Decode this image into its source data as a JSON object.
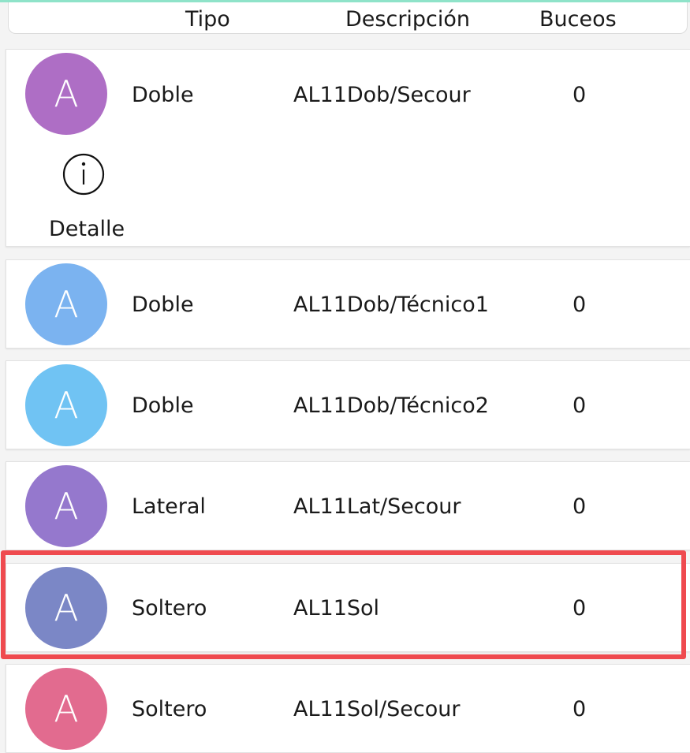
{
  "header": {
    "col_tipo": "Tipo",
    "col_descripcion": "Descripción",
    "col_buceos": "Buceos"
  },
  "rows": [
    {
      "avatar_letter": "A",
      "avatar_color": "#ae6ec5",
      "tipo": "Doble",
      "descripcion": "AL11Dob/Secour",
      "buceos": "0"
    },
    {
      "avatar_letter": "A",
      "avatar_color": "#7bb3f0",
      "tipo": "Doble",
      "descripcion": "AL11Dob/Técnico1",
      "buceos": "0"
    },
    {
      "avatar_letter": "A",
      "avatar_color": "#70c3f3",
      "tipo": "Doble",
      "descripcion": "AL11Dob/Técnico2",
      "buceos": "0"
    },
    {
      "avatar_letter": "A",
      "avatar_color": "#9578cd",
      "tipo": "Lateral",
      "descripcion": "AL11Lat/Secour",
      "buceos": "0"
    },
    {
      "avatar_letter": "A",
      "avatar_color": "#7b87c6",
      "tipo": "Soltero",
      "descripcion": "AL11Sol",
      "buceos": "0"
    },
    {
      "avatar_letter": "A",
      "avatar_color": "#e26b8f",
      "tipo": "Soltero",
      "descripcion": "AL11Sol/Secour",
      "buceos": "0"
    }
  ],
  "expanded_row": {
    "icon": "info-icon",
    "detail_label": "Detalle"
  },
  "colors": {
    "highlight": "#ef4a4f",
    "accent": "#8fe3c9"
  }
}
